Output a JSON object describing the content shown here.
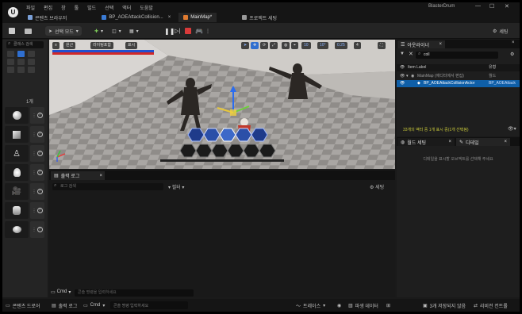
{
  "app": {
    "logo_letter": "U",
    "project_name": "BlasterDrum",
    "menu": [
      "파일",
      "편집",
      "창",
      "툴",
      "빌드",
      "선택",
      "액터",
      "도움말"
    ],
    "tabs": [
      {
        "label": "콘텐츠 브라우저",
        "color": "#7aa0d8"
      },
      {
        "label": "BP_AOEAttackCollision...",
        "color": "#3a7bd5"
      },
      {
        "label": "MainMap*",
        "color": "#e07b30"
      },
      {
        "label": "프로젝트 세팅",
        "color": "#999999"
      }
    ]
  },
  "toolbar": {
    "mode_label": "선택 모드",
    "settings_label": "세팅"
  },
  "left_panel": {
    "search_placeholder": "클래스 검색",
    "count_label": "1개",
    "items": [
      {
        "icon": "sphere-icon"
      },
      {
        "icon": "cube-icon"
      },
      {
        "icon": "person-icon"
      },
      {
        "icon": "light-bulb-icon"
      },
      {
        "icon": "camera-icon"
      },
      {
        "icon": "volume-icon"
      },
      {
        "icon": "shape-icon"
      }
    ]
  },
  "viewport": {
    "perspective_label": "원근",
    "lit_label": "라이팅포함",
    "show_label": "표시",
    "snap_values": [
      "10",
      "10°",
      "0.25",
      "4"
    ]
  },
  "output_log": {
    "tab_label": "출력 로그",
    "filter_placeholder": "로그 검색",
    "filter_label": "필터",
    "settings_label": "세팅",
    "cmd_label": "Cmd",
    "cmd_placeholder": "콘솔 명령을 입력하세요"
  },
  "outliner": {
    "tab_label": "아웃라이너",
    "search_value": "coll",
    "header_label": "Item Label",
    "header_type": "유형",
    "rows": [
      {
        "label": "MainMap (에디터에서 편집)",
        "type": "월드"
      },
      {
        "label": "BP_AOEAttackCollisionActor",
        "type": "BP_AOEAttack"
      }
    ],
    "status_text": "33개의 액터 중 1개 표시 중(1개 선택됨)"
  },
  "details": {
    "tab_label_1": "월드 세팅",
    "tab_label_2": "디테일",
    "empty_text": "디테일을 표시할 오브젝트를 선택해 주세요"
  },
  "statusbar": {
    "content_drawer": "콘텐츠 드로어",
    "output_log": "출력 로그",
    "cmd": "Cmd",
    "cmd_placeholder": "콘솔 명령 입력하세요",
    "trace": "트레이스",
    "derived_data": "파생 데이터",
    "unsaved": "3개 저장되지 않음",
    "revision": "리비전 컨트롤"
  },
  "colors": {
    "accent_blue": "#2f6fd0",
    "play_green": "#52c652",
    "stop_red": "#d83a3a",
    "status_text_yellow": "#c8c83a",
    "selected_row": "#0f5fa8"
  }
}
